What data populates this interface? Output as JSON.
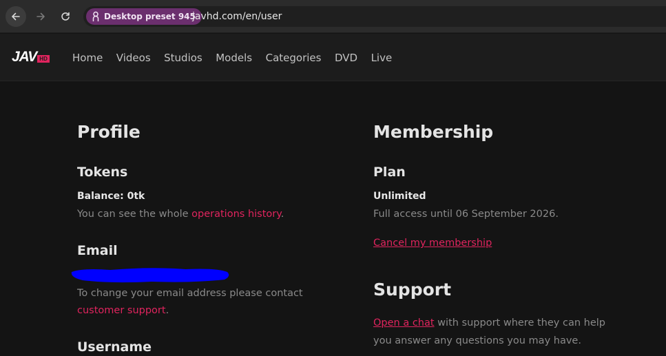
{
  "browser": {
    "preset_label": "Desktop preset 945",
    "url": "javhd.com/en/user",
    "icons": [
      "back-arrow-icon",
      "forward-arrow-icon",
      "reload-icon",
      "person-icon"
    ]
  },
  "site": {
    "logo_text": "JAV",
    "logo_badge": "HD",
    "nav": [
      "Home",
      "Videos",
      "Studios",
      "Models",
      "Categories",
      "DVD",
      "Live"
    ]
  },
  "profile": {
    "title": "Profile",
    "tokens_heading": "Tokens",
    "balance": "Balance: 0tk",
    "ops_prefix": "You can see the whole ",
    "ops_link": "operations history",
    "ops_suffix": ".",
    "email_heading": "Email",
    "email_note_line1": "To change your email address please contact",
    "email_note_link": "customer support",
    "email_note_suffix": ".",
    "username_heading": "Username"
  },
  "membership": {
    "title": "Membership",
    "plan_heading": "Plan",
    "plan_name": "Unlimited",
    "access_note": "Full access until 06 September 2026.",
    "cancel_link": "Cancel my membership"
  },
  "support": {
    "title": "Support",
    "chat_link": "Open a chat",
    "line1_rest": " with support where they can help",
    "line2": "you answer any questions you may have."
  },
  "colors": {
    "accent": "#e0245e",
    "background": "#141414",
    "header": "#1c1c1c",
    "redaction": "#0000ff"
  }
}
